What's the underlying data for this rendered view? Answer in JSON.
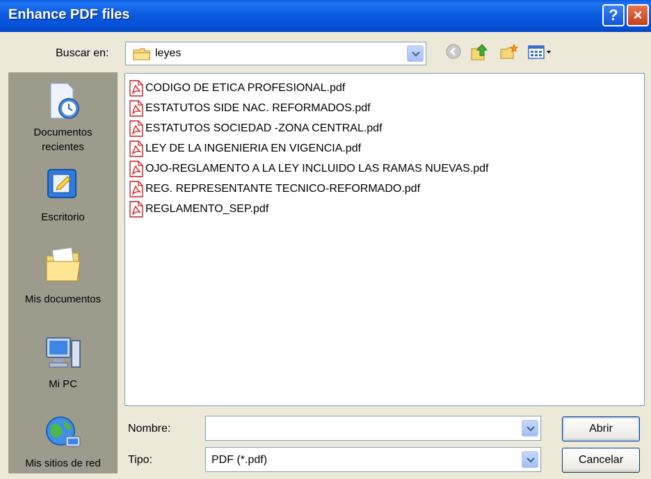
{
  "window": {
    "title": "Enhance PDF files",
    "help": "?",
    "close": "×"
  },
  "lookin": {
    "label": "Buscar en:",
    "value": "leyes"
  },
  "places": [
    {
      "label_lines": [
        "Documentos",
        "recientes"
      ],
      "icon": "recent-documents-icon"
    },
    {
      "label_lines": [
        "Escritorio"
      ],
      "icon": "desktop-icon"
    },
    {
      "label_lines": [
        "Mis documentos"
      ],
      "icon": "my-documents-icon"
    },
    {
      "label_lines": [
        "Mi PC"
      ],
      "icon": "my-computer-icon"
    },
    {
      "label_lines": [
        "Mis sitios de red"
      ],
      "icon": "network-places-icon"
    }
  ],
  "files": [
    "CODIGO DE ETICA PROFESIONAL.pdf",
    "ESTATUTOS SIDE NAC. REFORMADOS.pdf",
    "ESTATUTOS SOCIEDAD -ZONA CENTRAL.pdf",
    "LEY DE LA INGENIERIA EN VIGENCIA.pdf",
    "OJO-REGLAMENTO A LA LEY INCLUIDO LAS RAMAS NUEVAS.pdf",
    "REG. REPRESENTANTE TECNICO-REFORMADO.pdf",
    "REGLAMENTO_SEP.pdf"
  ],
  "filename": {
    "label": "Nombre:",
    "value": ""
  },
  "filetype": {
    "label": "Tipo:",
    "value": "PDF (*.pdf)"
  },
  "buttons": {
    "open": "Abrir",
    "cancel": "Cancelar"
  },
  "colors": {
    "titlebar": "#0a5ce0",
    "places_panel": "#9d9c8c",
    "dialog_bg": "#ece9d8"
  }
}
